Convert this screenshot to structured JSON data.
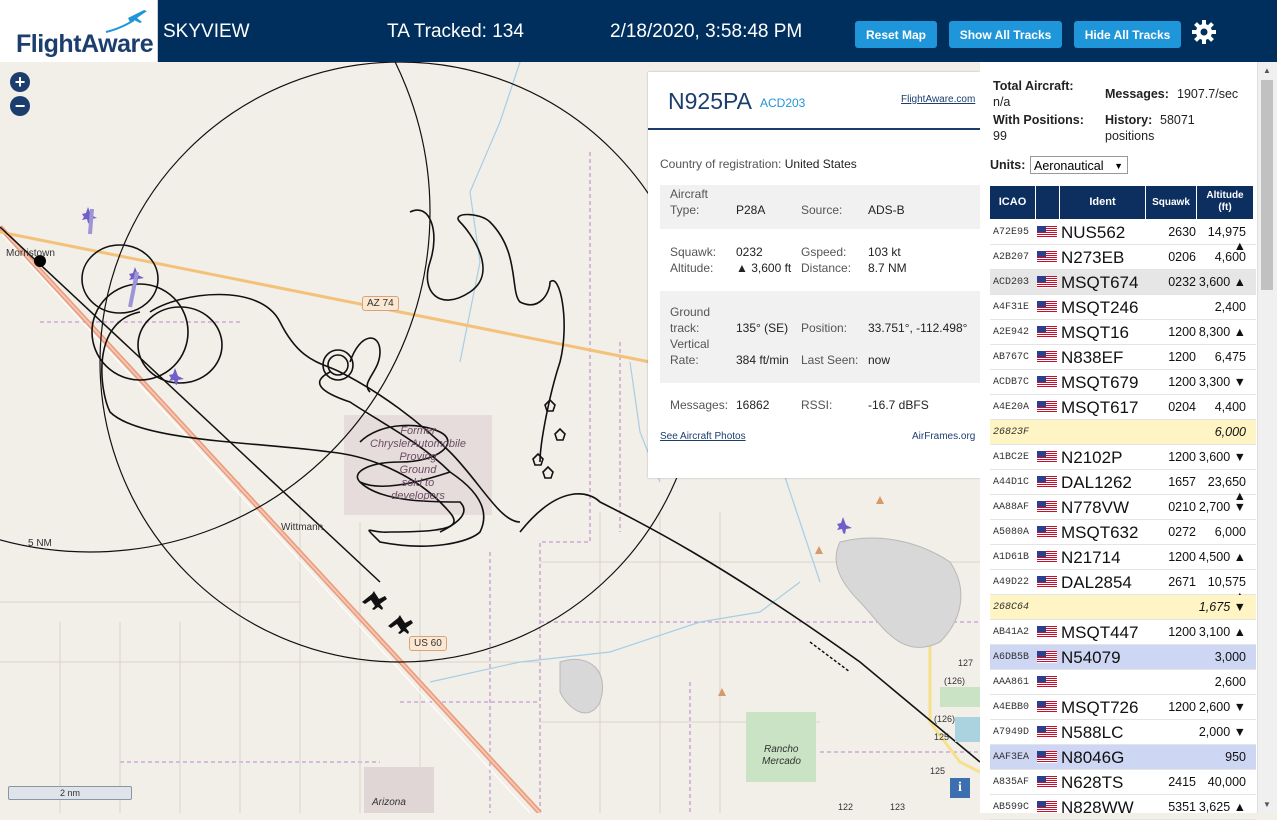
{
  "header": {
    "logo_text": "FlightAware",
    "title": "SKYVIEW",
    "tracked": "TA Tracked: 134",
    "datetime": "2/18/2020, 3:58:48 PM",
    "btn_reset": "Reset Map",
    "btn_show": "Show All Tracks",
    "btn_hide": "Hide All Tracks"
  },
  "map": {
    "zoom_in": "+",
    "zoom_out": "−",
    "labels": {
      "morristown": "Morristown",
      "az74": "AZ 74",
      "former1": "Former",
      "former2": "ChryslerAutomobile",
      "former3": "Proving",
      "former4": "Ground",
      "former5": "sold to",
      "former6": "developers",
      "wittmann": "Wittmann",
      "us60": "US 60",
      "ring": "5 NM",
      "rancho1": "Rancho",
      "rancho2": "Mercado",
      "arizona": "Arizona",
      "r127": "127",
      "r126a": "(126)",
      "r126b": "(126)",
      "r125a": "125",
      "r125b": "125",
      "r123": "123",
      "r122": "122"
    },
    "scale": "2 nm",
    "info": "i"
  },
  "popup": {
    "registration": "N925PA",
    "hex": "ACD203",
    "link": "FlightAware.com",
    "country_label": "Country of registration:",
    "country": "United States",
    "aircraft_type_label1": "Aircraft",
    "aircraft_type_label2": "Type:",
    "aircraft_type": "P28A",
    "source_label": "Source:",
    "source": "ADS-B",
    "squawk_label": "Squawk:",
    "squawk": "0232",
    "gspeed_label": "Gspeed:",
    "gspeed": "103 kt",
    "altitude_label": "Altitude:",
    "altitude": "▲ 3,600 ft",
    "distance_label": "Distance:",
    "distance": "8.7 NM",
    "track_label1": "Ground",
    "track_label2": "track:",
    "track": "135° (SE)",
    "position_label": "Position:",
    "position": "33.751°, -112.498°",
    "vrate_label1": "Vertical",
    "vrate_label2": "Rate:",
    "vrate": "384 ft/min",
    "lastseen_label": "Last Seen:",
    "lastseen": "now",
    "messages_label": "Messages:",
    "messages": "16862",
    "rssi_label": "RSSI:",
    "rssi": "-16.7 dBFS",
    "photos_link": "See Aircraft Photos",
    "airframes_link": "AirFrames.org"
  },
  "side": {
    "total_label": "Total Aircraft:",
    "total": "n/a",
    "messages_label": "Messages:",
    "messages": "1907.7/sec",
    "withpos_label": "With Positions:",
    "withpos": "99",
    "history_label": "History:",
    "history1": "58071",
    "history2": "positions",
    "units_label": "Units:",
    "units": "Aeronautical",
    "col_icao": "ICAO",
    "col_ident": "Ident",
    "col_squawk": "Squawk",
    "col_alt1": "Altitude",
    "col_alt2": "(ft)"
  },
  "rows": [
    {
      "icao": "A72E95",
      "ident": "NUS562",
      "squawk": "2630",
      "alt": "14,975 ▲",
      "flag": true,
      "hl": ""
    },
    {
      "icao": "A2B207",
      "ident": "N273EB",
      "squawk": "0206",
      "alt": "4,600",
      "flag": true,
      "hl": ""
    },
    {
      "icao": "ACD203",
      "ident": "MSQT674",
      "squawk": "0232",
      "alt": "3,600 ▲",
      "flag": true,
      "hl": "gray"
    },
    {
      "icao": "A4F31E",
      "ident": "MSQT246",
      "squawk": "",
      "alt": "2,400",
      "flag": true,
      "hl": ""
    },
    {
      "icao": "A2E942",
      "ident": "MSQT16",
      "squawk": "1200",
      "alt": "8,300 ▲",
      "flag": true,
      "hl": ""
    },
    {
      "icao": "AB767C",
      "ident": "N838EF",
      "squawk": "1200",
      "alt": "6,475",
      "flag": true,
      "hl": ""
    },
    {
      "icao": "ACDB7C",
      "ident": "MSQT679",
      "squawk": "1200",
      "alt": "3,300 ▼",
      "flag": true,
      "hl": ""
    },
    {
      "icao": "A4E20A",
      "ident": "MSQT617",
      "squawk": "0204",
      "alt": "4,400",
      "flag": true,
      "hl": ""
    },
    {
      "icao": "26823F",
      "ident": "",
      "squawk": "",
      "alt": "6,000",
      "flag": false,
      "hl": "yellow"
    },
    {
      "icao": "A1BC2E",
      "ident": "N2102P",
      "squawk": "1200",
      "alt": "3,600 ▼",
      "flag": true,
      "hl": ""
    },
    {
      "icao": "A44D1C",
      "ident": "DAL1262",
      "squawk": "1657",
      "alt": "23,650 ▲",
      "flag": true,
      "hl": ""
    },
    {
      "icao": "AA88AF",
      "ident": "N778VW",
      "squawk": "0210",
      "alt": "2,700 ▼",
      "flag": true,
      "hl": ""
    },
    {
      "icao": "A5080A",
      "ident": "MSQT632",
      "squawk": "0272",
      "alt": "6,000",
      "flag": true,
      "hl": ""
    },
    {
      "icao": "A1D61B",
      "ident": "N21714",
      "squawk": "1200",
      "alt": "4,500 ▲",
      "flag": true,
      "hl": ""
    },
    {
      "icao": "A49D22",
      "ident": "DAL2854",
      "squawk": "2671",
      "alt": "10,575 ▲",
      "flag": true,
      "hl": ""
    },
    {
      "icao": "268C64",
      "ident": "",
      "squawk": "",
      "alt": "1,675 ▼",
      "flag": false,
      "hl": "yellow"
    },
    {
      "icao": "AB41A2",
      "ident": "MSQT447",
      "squawk": "1200",
      "alt": "3,100 ▲",
      "flag": true,
      "hl": ""
    },
    {
      "icao": "A6DB5B",
      "ident": "N54079",
      "squawk": "",
      "alt": "3,000",
      "flag": true,
      "hl": "blue"
    },
    {
      "icao": "AAA861",
      "ident": "",
      "squawk": "",
      "alt": "2,600",
      "flag": true,
      "hl": ""
    },
    {
      "icao": "A4EBB0",
      "ident": "MSQT726",
      "squawk": "1200",
      "alt": "2,600 ▼",
      "flag": true,
      "hl": ""
    },
    {
      "icao": "A7949D",
      "ident": "N588LC",
      "squawk": "",
      "alt": "2,000 ▼",
      "flag": true,
      "hl": ""
    },
    {
      "icao": "AAF3EA",
      "ident": "N8046G",
      "squawk": "",
      "alt": "950",
      "flag": true,
      "hl": "blue"
    },
    {
      "icao": "A835AF",
      "ident": "N628TS",
      "squawk": "2415",
      "alt": "40,000",
      "flag": true,
      "hl": ""
    },
    {
      "icao": "AB599C",
      "ident": "N828WW",
      "squawk": "5351",
      "alt": "3,625 ▲",
      "flag": true,
      "hl": ""
    }
  ],
  "colors": {
    "header_bg": "#002f5d",
    "button_bg": "#1f96d9",
    "table_head_bg": "#0c2f60",
    "highlight_gray": "#e6e6e6",
    "highlight_yellow": "#fff4c4",
    "highlight_blue": "#cdd6f2"
  }
}
